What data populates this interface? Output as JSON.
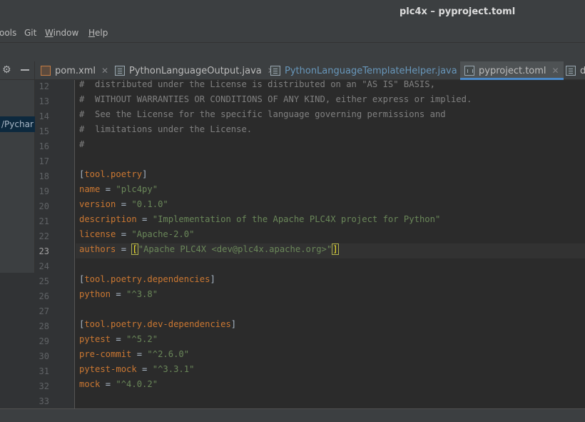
{
  "window": {
    "title": "plc4x – pyproject.toml"
  },
  "menu": [
    {
      "label": "ools",
      "mnemonic_index": -1
    },
    {
      "label": "Git",
      "mnemonic_index": -1
    },
    {
      "label": "Window",
      "mnemonic_index": 0
    },
    {
      "label": "Help",
      "mnemonic_index": 0
    }
  ],
  "project_panel": {
    "path_fragment": "/Pychar"
  },
  "tabs": [
    {
      "label": "pom.xml",
      "icon": "xml-icon",
      "state": "normal"
    },
    {
      "label": "PythonLanguageOutput.java",
      "icon": "java-icon",
      "state": "normal"
    },
    {
      "label": "PythonLanguageTemplateHelper.java",
      "icon": "java-icon",
      "state": "modified"
    },
    {
      "label": "pyproject.toml",
      "icon": "toml-icon",
      "state": "active"
    },
    {
      "label": "da",
      "icon": "java-icon",
      "state": "partial"
    }
  ],
  "editor": {
    "current_line": 23,
    "lines": [
      {
        "num": "12",
        "tokens": [
          {
            "t": "#  distributed under the License is distributed on an \"AS IS\" BASIS,",
            "c": "comment"
          }
        ]
      },
      {
        "num": "13",
        "tokens": [
          {
            "t": "#  WITHOUT WARRANTIES OR CONDITIONS OF ANY KIND, either express or implied.",
            "c": "comment"
          }
        ]
      },
      {
        "num": "14",
        "tokens": [
          {
            "t": "#  See the License for the specific language governing permissions and",
            "c": "comment"
          }
        ]
      },
      {
        "num": "15",
        "tokens": [
          {
            "t": "#  limitations under the License.",
            "c": "comment"
          }
        ]
      },
      {
        "num": "16",
        "tokens": [
          {
            "t": "#",
            "c": "comment"
          }
        ]
      },
      {
        "num": "17",
        "tokens": []
      },
      {
        "num": "18",
        "tokens": [
          {
            "t": "[",
            "c": "bracket"
          },
          {
            "t": "tool.poetry",
            "c": "section"
          },
          {
            "t": "]",
            "c": "bracket"
          }
        ]
      },
      {
        "num": "19",
        "tokens": [
          {
            "t": "name",
            "c": "key"
          },
          {
            "t": " = ",
            "c": "eq"
          },
          {
            "t": "\"plc4py\"",
            "c": "str"
          }
        ]
      },
      {
        "num": "20",
        "tokens": [
          {
            "t": "version",
            "c": "key"
          },
          {
            "t": " = ",
            "c": "eq"
          },
          {
            "t": "\"0.1.0\"",
            "c": "str"
          }
        ]
      },
      {
        "num": "21",
        "tokens": [
          {
            "t": "description",
            "c": "key"
          },
          {
            "t": " = ",
            "c": "eq"
          },
          {
            "t": "\"Implementation of the Apache PLC4X project for Python\"",
            "c": "str"
          }
        ]
      },
      {
        "num": "22",
        "tokens": [
          {
            "t": "license",
            "c": "key"
          },
          {
            "t": " = ",
            "c": "eq"
          },
          {
            "t": "\"Apache-2.0\"",
            "c": "str"
          }
        ]
      },
      {
        "num": "23",
        "tokens": [
          {
            "t": "authors",
            "c": "key"
          },
          {
            "t": " = ",
            "c": "eq"
          },
          {
            "t": "[",
            "c": "match"
          },
          {
            "t": "\"Apache PLC4X <dev@plc4x.apache.org>\"",
            "c": "str"
          },
          {
            "t": "]",
            "c": "match"
          }
        ]
      },
      {
        "num": "24",
        "tokens": []
      },
      {
        "num": "25",
        "tokens": [
          {
            "t": "[",
            "c": "bracket"
          },
          {
            "t": "tool.poetry.dependencies",
            "c": "section"
          },
          {
            "t": "]",
            "c": "bracket"
          }
        ]
      },
      {
        "num": "26",
        "tokens": [
          {
            "t": "python",
            "c": "key"
          },
          {
            "t": " = ",
            "c": "eq"
          },
          {
            "t": "\"^3.8\"",
            "c": "str"
          }
        ]
      },
      {
        "num": "27",
        "tokens": []
      },
      {
        "num": "28",
        "tokens": [
          {
            "t": "[",
            "c": "bracket"
          },
          {
            "t": "tool.poetry.dev-dependencies",
            "c": "section"
          },
          {
            "t": "]",
            "c": "bracket"
          }
        ]
      },
      {
        "num": "29",
        "tokens": [
          {
            "t": "pytest",
            "c": "key"
          },
          {
            "t": " = ",
            "c": "eq"
          },
          {
            "t": "\"^5.2\"",
            "c": "str"
          }
        ]
      },
      {
        "num": "30",
        "tokens": [
          {
            "t": "pre-commit",
            "c": "key"
          },
          {
            "t": " = ",
            "c": "eq"
          },
          {
            "t": "\"^2.6.0\"",
            "c": "str"
          }
        ]
      },
      {
        "num": "31",
        "tokens": [
          {
            "t": "pytest-mock",
            "c": "key"
          },
          {
            "t": " = ",
            "c": "eq"
          },
          {
            "t": "\"^3.3.1\"",
            "c": "str"
          }
        ]
      },
      {
        "num": "32",
        "tokens": [
          {
            "t": "mock",
            "c": "key"
          },
          {
            "t": " = ",
            "c": "eq"
          },
          {
            "t": "\"^4.0.2\"",
            "c": "str"
          }
        ]
      },
      {
        "num": "33",
        "tokens": []
      }
    ]
  }
}
